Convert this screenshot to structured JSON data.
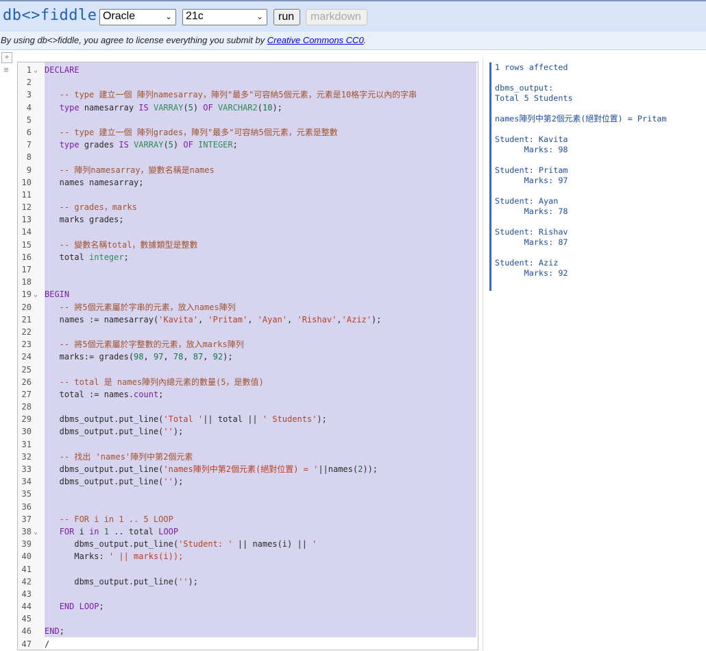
{
  "header": {
    "logo": "db<>fiddle",
    "database": "Oracle",
    "version": "21c",
    "run_label": "run",
    "markdown_label": "markdown"
  },
  "notice": {
    "prefix": "By using db<>fiddle, you agree to license everything you submit by ",
    "link": "Creative Commons CC0",
    "suffix": "."
  },
  "editor": {
    "lines": [
      {
        "n": "1",
        "fold": "⌄",
        "code": "DECLARE"
      },
      {
        "n": "2",
        "code": ""
      },
      {
        "n": "3",
        "code": "   -- type 建立一個 陣列namesarray，陣列\"最多\"可容納5個元素，元素是10格字元以內的字串"
      },
      {
        "n": "4",
        "code": "   type namesarray IS VARRAY(5) OF VARCHAR2(10);"
      },
      {
        "n": "5",
        "code": ""
      },
      {
        "n": "6",
        "code": "   -- type 建立一個 陣列grades，陣列\"最多\"可容納5個元素，元素是整數"
      },
      {
        "n": "7",
        "code": "   type grades IS VARRAY(5) OF INTEGER;"
      },
      {
        "n": "8",
        "code": ""
      },
      {
        "n": "9",
        "code": "   -- 陣列namesarray，變數名稱是names"
      },
      {
        "n": "10",
        "code": "   names namesarray;"
      },
      {
        "n": "11",
        "code": ""
      },
      {
        "n": "12",
        "code": "   -- grades，marks"
      },
      {
        "n": "13",
        "code": "   marks grades;"
      },
      {
        "n": "14",
        "code": ""
      },
      {
        "n": "15",
        "code": "   -- 變數名稱total，數據類型是整數"
      },
      {
        "n": "16",
        "code": "   total integer;"
      },
      {
        "n": "17",
        "code": ""
      },
      {
        "n": "18",
        "code": ""
      },
      {
        "n": "19",
        "fold": "⌄",
        "code": "BEGIN"
      },
      {
        "n": "20",
        "code": "   -- 將5個元素屬於字串的元素，放入names陣列"
      },
      {
        "n": "21",
        "code": "   names := namesarray('Kavita', 'Pritam', 'Ayan', 'Rishav','Aziz');"
      },
      {
        "n": "22",
        "code": ""
      },
      {
        "n": "23",
        "code": "   -- 將5個元素屬於字整數的元素，放入marks陣列"
      },
      {
        "n": "24",
        "code": "   marks:= grades(98, 97, 78, 87, 92);"
      },
      {
        "n": "25",
        "code": ""
      },
      {
        "n": "26",
        "code": "   -- total 是 names陣列內總元素的數量(5，是數值)"
      },
      {
        "n": "27",
        "code": "   total := names.count;"
      },
      {
        "n": "28",
        "code": ""
      },
      {
        "n": "29",
        "code": "   dbms_output.put_line('Total '|| total || ' Students');"
      },
      {
        "n": "30",
        "code": "   dbms_output.put_line('');"
      },
      {
        "n": "31",
        "code": ""
      },
      {
        "n": "32",
        "code": "   -- 找出 'names'陣列中第2個元素"
      },
      {
        "n": "33",
        "code": "   dbms_output.put_line('names陣列中第2個元素(絕對位置) = '||names(2));"
      },
      {
        "n": "34",
        "code": "   dbms_output.put_line('');"
      },
      {
        "n": "35",
        "code": ""
      },
      {
        "n": "36",
        "code": ""
      },
      {
        "n": "37",
        "code": "   -- FOR i in 1 .. 5 LOOP"
      },
      {
        "n": "38",
        "fold": "⌄",
        "code": "   FOR i in 1 .. total LOOP"
      },
      {
        "n": "39",
        "code": "      dbms_output.put_line('Student: ' || names(i) || '"
      },
      {
        "n": "40",
        "code": "      Marks: ' || marks(i));"
      },
      {
        "n": "41",
        "code": ""
      },
      {
        "n": "42",
        "code": "      dbms_output.put_line('');"
      },
      {
        "n": "43",
        "code": ""
      },
      {
        "n": "44",
        "code": "   END LOOP;"
      },
      {
        "n": "45",
        "code": ""
      },
      {
        "n": "46",
        "code": "END;"
      },
      {
        "n": "47",
        "code": "/"
      }
    ]
  },
  "output": {
    "lines": [
      "1 rows affected",
      "",
      "dbms_output:",
      "Total 5 Students",
      "",
      "names陣列中第2個元素(絕對位置) = Pritam",
      "",
      "Student: Kavita",
      "      Marks: 98",
      "",
      "Student: Pritam",
      "      Marks: 97",
      "",
      "Student: Ayan",
      "      Marks: 78",
      "",
      "Student: Rishav",
      "      Marks: 87",
      "",
      "Student: Aziz",
      "      Marks: 92"
    ]
  }
}
